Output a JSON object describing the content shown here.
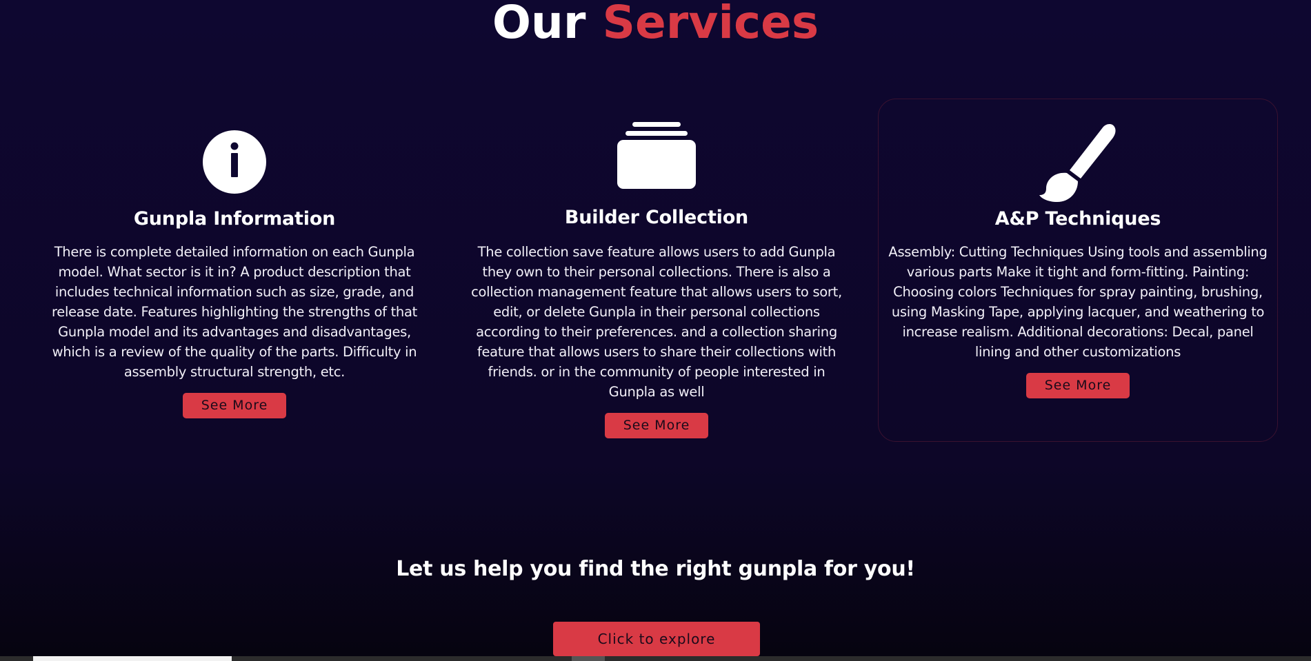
{
  "section": {
    "title_word1": "Our",
    "title_word2": "Services"
  },
  "cards": [
    {
      "icon": "info-circle-icon",
      "title": "Gunpla Information",
      "description": "There is complete detailed information on each Gunpla model. What sector is it in? A product description that includes technical information such as size, grade, and release date. Features highlighting the strengths of that Gunpla model and its advantages and disadvantages, which is a review of the quality of the parts. Difficulty in assembly structural strength, etc.",
      "button": "See More"
    },
    {
      "icon": "collection-box-icon",
      "title": "Builder Collection",
      "description": "The collection save feature allows users to add Gunpla they own to their personal collections. There is also a collection management feature that allows users to sort, edit, or delete Gunpla in their personal collections according to their preferences. and a collection sharing feature that allows users to share their collections with friends. or in the community of people interested in Gunpla as well",
      "button": "See More"
    },
    {
      "icon": "paint-brush-icon",
      "title": "A&P Techniques",
      "description": "Assembly: Cutting Techniques Using tools and assembling various parts Make it tight and form-fitting. Painting: Choosing colors Techniques for spray painting, brushing, using Masking Tape, applying lacquer, and weathering to increase realism. Additional decorations: Decal, panel lining and other customizations",
      "button": "See More"
    }
  ],
  "cta": {
    "heading": "Let us help you find the right gunpla for you!",
    "button": "Click to explore"
  },
  "colors": {
    "background": "#0e0730",
    "accent": "#d93a45",
    "text": "#ffffff",
    "card_border": "#3a1230"
  }
}
